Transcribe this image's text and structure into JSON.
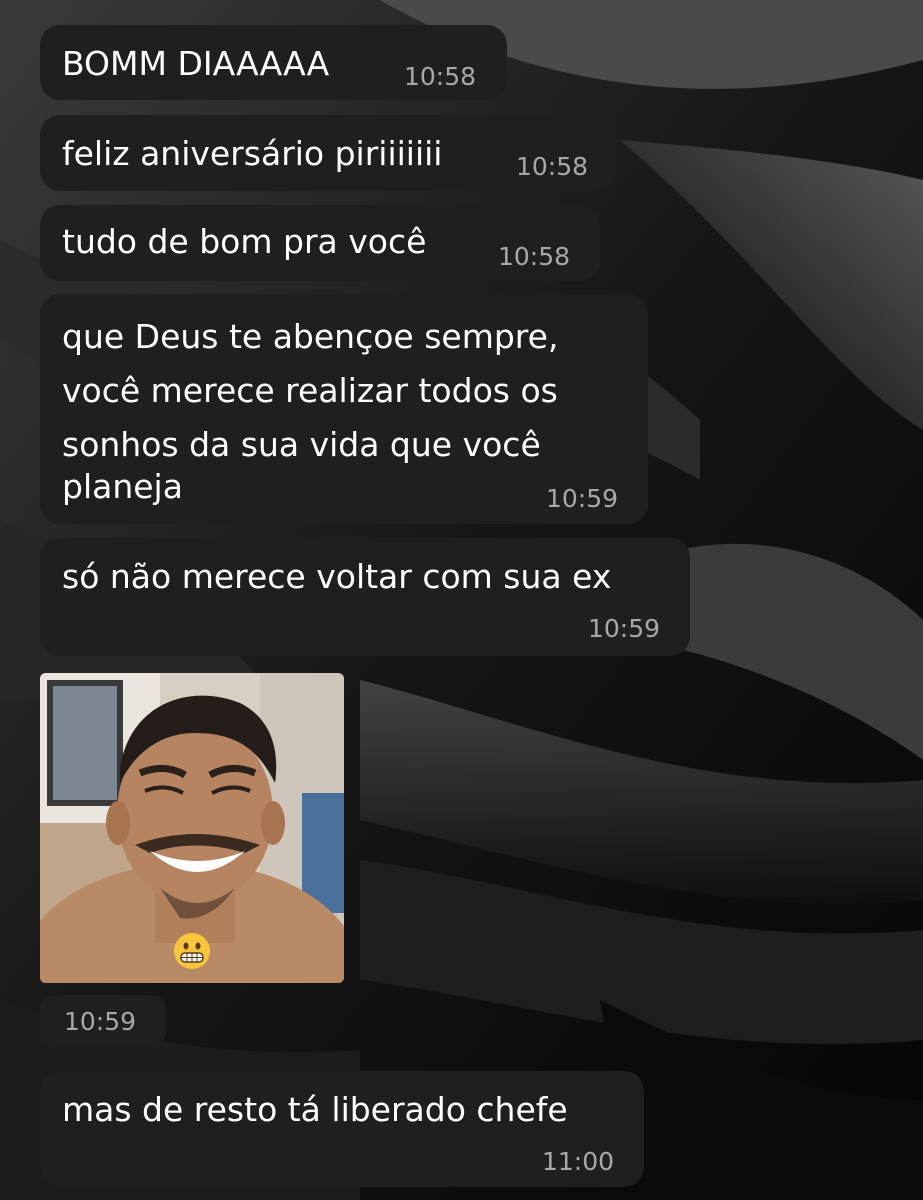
{
  "chat": {
    "messages": [
      {
        "text": "BOMM DIAAAAA",
        "time": "10:58"
      },
      {
        "text": "feliz aniversário piriiiiiii",
        "time": "10:58"
      },
      {
        "text": "tudo de bom pra você",
        "time": "10:58"
      },
      {
        "lines": [
          "que Deus te abençoe sempre,",
          "você merece realizar todos os",
          "sonhos da sua vida que você",
          "planeja"
        ],
        "time": "10:59"
      },
      {
        "text": "só não merece voltar com sua ex",
        "time": "10:59"
      },
      {
        "text": "mas de resto tá liberado chefe",
        "time": "11:00"
      }
    ],
    "photo": {
      "emoji": "grinning-face-icon",
      "time": "10:59"
    }
  },
  "colors": {
    "bubble": "#1f1f1f",
    "text": "#ffffff",
    "timestamp": "#a8a8a8",
    "wallpaper": "#1a1a1a"
  }
}
